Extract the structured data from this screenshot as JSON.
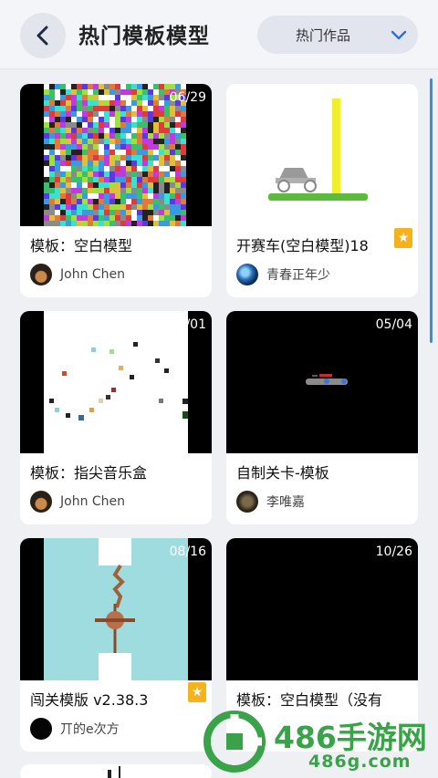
{
  "header": {
    "title": "热门模板模型",
    "filter_label": "热门作品"
  },
  "cards": [
    {
      "date": "06/29",
      "title": "模板：空白模型",
      "author": "John Chen",
      "starred": false
    },
    {
      "date": "",
      "title": "开赛车(空白模型)18",
      "author": "青春正年少",
      "starred": true
    },
    {
      "date": "/01",
      "title": "模板：指尖音乐盒",
      "author": "John Chen",
      "starred": false
    },
    {
      "date": "05/04",
      "title": "自制关卡-模板",
      "author": "李唯嘉",
      "starred": false
    },
    {
      "date": "08/16",
      "title": "闯关模版 v2.38.3",
      "author": "丌的e次方",
      "starred": true
    },
    {
      "date": "10/26",
      "title": "模板：空白模型（没有",
      "author": "",
      "starred": false
    }
  ],
  "watermark": {
    "brand": "486手游网",
    "domain": "486g.com"
  },
  "colors": {
    "accent": "#2f8ff0",
    "star": "#f6b21c",
    "watermark_green": "#3aa34a"
  }
}
